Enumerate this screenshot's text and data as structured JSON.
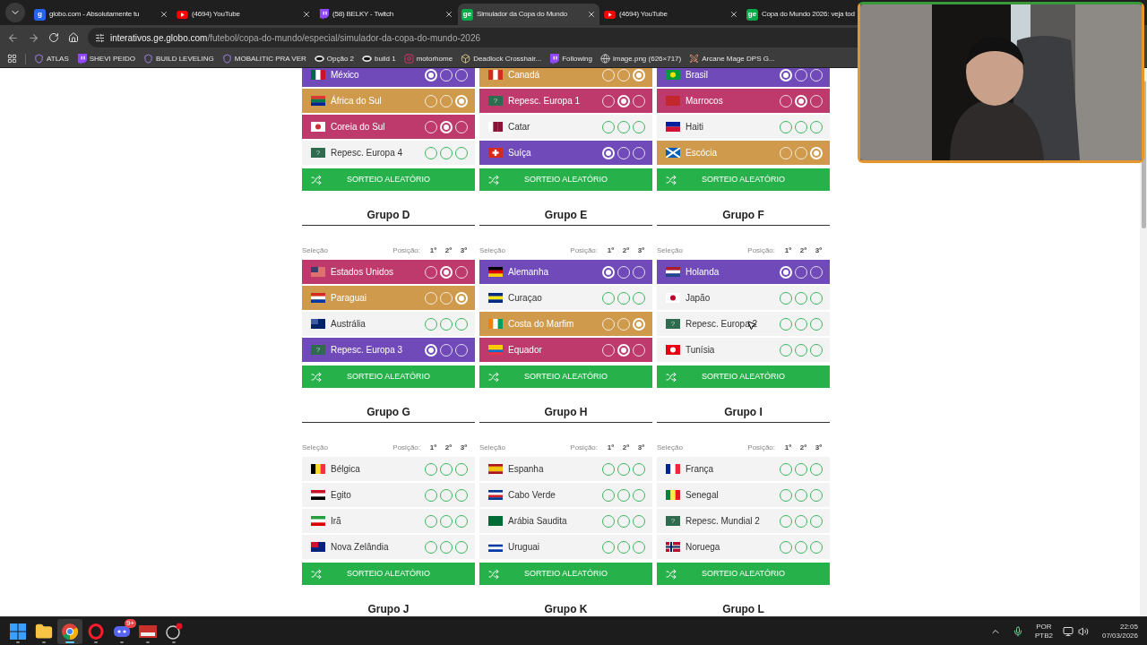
{
  "browser": {
    "tabs": [
      {
        "label": "globo.com - Absolutamente tu",
        "favicon": {
          "kind": "globo",
          "text": "g"
        },
        "selected": false
      },
      {
        "label": "(4694) YouTube",
        "favicon": {
          "kind": "youtube"
        },
        "selected": false
      },
      {
        "label": "(58) BELKY - Twitch",
        "favicon": {
          "kind": "twitch"
        },
        "selected": false
      },
      {
        "label": "Simulador da Copa do Mundo",
        "favicon": {
          "kind": "ge",
          "text": "ge"
        },
        "selected": true
      },
      {
        "label": "(4694) YouTube",
        "favicon": {
          "kind": "youtube"
        },
        "selected": false
      },
      {
        "label": "Copa do Mundo 2026: veja tod",
        "favicon": {
          "kind": "ge",
          "text": "ge"
        },
        "selected": false
      }
    ],
    "url_host": "interativos.ge.globo.com",
    "url_path": "/futebol/copa-do-mundo/especial/simulador-da-copa-do-mundo-2026",
    "bookmarks": [
      "ATLAS",
      "SHEVI PEIDO",
      "BUILD LEVELING",
      "MOBALITIC PRA VER",
      "Opção 2",
      "build 1",
      "motorhome",
      "Deadlock Crosshair...",
      "Following",
      "image.png (626×717)",
      "Arcane Mage DPS G..."
    ]
  },
  "groups": [
    {
      "button": "SORTEIO ALEATÓRIO",
      "teams": [
        {
          "name": "México",
          "picks": [
            true,
            false,
            false
          ]
        },
        {
          "name": "África do Sul",
          "picks": [
            false,
            false,
            true
          ]
        },
        {
          "name": "Coreia do Sul",
          "picks": [
            false,
            true,
            false
          ]
        },
        {
          "name": "Repesc. Europa 4",
          "flag_mark": "?",
          "picks": [
            false,
            false,
            false
          ]
        }
      ]
    },
    {
      "button": "SORTEIO ALEATÓRIO",
      "teams": [
        {
          "name": "Canadá",
          "picks": [
            false,
            false,
            true
          ]
        },
        {
          "name": "Repesc. Europa 1",
          "flag_mark": "?",
          "picks": [
            false,
            true,
            false
          ]
        },
        {
          "name": "Catar",
          "picks": [
            false,
            false,
            false
          ]
        },
        {
          "name": "Suíça",
          "picks": [
            true,
            false,
            false
          ]
        }
      ]
    },
    {
      "button": "SORTEIO ALEATÓRIO",
      "teams": [
        {
          "name": "Brasil",
          "picks": [
            true,
            false,
            false
          ]
        },
        {
          "name": "Marrocos",
          "picks": [
            false,
            true,
            false
          ]
        },
        {
          "name": "Haiti",
          "picks": [
            false,
            false,
            false
          ]
        },
        {
          "name": "Escócia",
          "picks": [
            false,
            false,
            true
          ]
        }
      ]
    },
    {
      "title": "Grupo D",
      "header": {
        "team": "Seleção",
        "position": "Posição:",
        "places": [
          "1º",
          "2º",
          "3º"
        ]
      },
      "button": "SORTEIO ALEATÓRIO",
      "teams": [
        {
          "name": "Estados Unidos",
          "picks": [
            false,
            true,
            false
          ]
        },
        {
          "name": "Paraguai",
          "picks": [
            false,
            false,
            true
          ]
        },
        {
          "name": "Austrália",
          "picks": [
            false,
            false,
            false
          ]
        },
        {
          "name": "Repesc. Europa 3",
          "flag_mark": "?",
          "picks": [
            true,
            false,
            false
          ]
        }
      ]
    },
    {
      "title": "Grupo E",
      "header": {
        "team": "Seleção",
        "position": "Posição:",
        "places": [
          "1º",
          "2º",
          "3º"
        ]
      },
      "button": "SORTEIO ALEATÓRIO",
      "teams": [
        {
          "name": "Alemanha",
          "picks": [
            true,
            false,
            false
          ]
        },
        {
          "name": "Curaçao",
          "picks": [
            false,
            false,
            false
          ]
        },
        {
          "name": "Costa do Marfim",
          "picks": [
            false,
            false,
            true
          ]
        },
        {
          "name": "Equador",
          "picks": [
            false,
            true,
            false
          ]
        }
      ]
    },
    {
      "title": "Grupo F",
      "header": {
        "team": "Seleção",
        "position": "Posição:",
        "places": [
          "1º",
          "2º",
          "3º"
        ]
      },
      "button": "SORTEIO ALEATÓRIO",
      "teams": [
        {
          "name": "Holanda",
          "picks": [
            true,
            false,
            false
          ]
        },
        {
          "name": "Japão",
          "picks": [
            false,
            false,
            false
          ]
        },
        {
          "name": "Repesc. Europa 2",
          "flag_mark": "?",
          "picks": [
            false,
            false,
            false
          ],
          "pointer": true
        },
        {
          "name": "Tunísia",
          "picks": [
            false,
            false,
            false
          ]
        }
      ]
    },
    {
      "title": "Grupo G",
      "header": {
        "team": "Seleção",
        "position": "Posição:",
        "places": [
          "1º",
          "2º",
          "3º"
        ]
      },
      "button": "SORTEIO ALEATÓRIO",
      "teams": [
        {
          "name": "Bélgica",
          "picks": [
            false,
            false,
            false
          ]
        },
        {
          "name": "Egito",
          "picks": [
            false,
            false,
            false
          ]
        },
        {
          "name": "Irã",
          "picks": [
            false,
            false,
            false
          ]
        },
        {
          "name": "Nova Zelândia",
          "picks": [
            false,
            false,
            false
          ]
        }
      ]
    },
    {
      "title": "Grupo H",
      "header": {
        "team": "Seleção",
        "position": "Posição:",
        "places": [
          "1º",
          "2º",
          "3º"
        ]
      },
      "button": "SORTEIO ALEATÓRIO",
      "teams": [
        {
          "name": "Espanha",
          "picks": [
            false,
            false,
            false
          ]
        },
        {
          "name": "Cabo Verde",
          "picks": [
            false,
            false,
            false
          ]
        },
        {
          "name": "Arábia Saudita",
          "picks": [
            false,
            false,
            false
          ]
        },
        {
          "name": "Uruguai",
          "picks": [
            false,
            false,
            false
          ]
        }
      ]
    },
    {
      "title": "Grupo I",
      "header": {
        "team": "Seleção",
        "position": "Posição:",
        "places": [
          "1º",
          "2º",
          "3º"
        ]
      },
      "button": "SORTEIO ALEATÓRIO",
      "teams": [
        {
          "name": "França",
          "picks": [
            false,
            false,
            false
          ]
        },
        {
          "name": "Senegal",
          "picks": [
            false,
            false,
            false
          ]
        },
        {
          "name": "Repesc. Mundial 2",
          "flag_mark": "?",
          "picks": [
            false,
            false,
            false
          ]
        },
        {
          "name": "Noruega",
          "picks": [
            false,
            false,
            false
          ]
        }
      ]
    },
    {
      "title": "Grupo J"
    },
    {
      "title": "Grupo K"
    },
    {
      "title": "Grupo L"
    }
  ],
  "taskbar": {
    "apps": [
      {
        "selected": false
      },
      {
        "selected": false
      },
      {
        "selected": true
      },
      {
        "selected": false
      },
      {
        "badge": "9+",
        "selected": false
      },
      {
        "selected": false
      },
      {
        "selected": false
      }
    ],
    "language": [
      "POR",
      "PTB2"
    ],
    "time": "22:05",
    "date": "07/03/2026"
  }
}
